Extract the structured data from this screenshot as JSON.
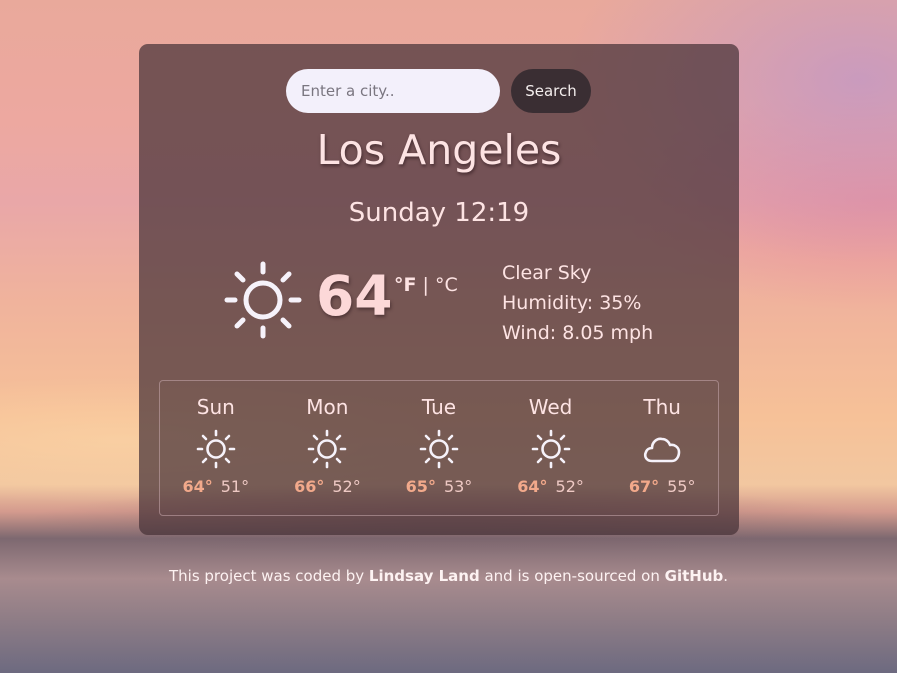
{
  "search": {
    "placeholder": "Enter a city..",
    "value": "",
    "button_label": "Search"
  },
  "current": {
    "city": "Los Angeles",
    "datetime": "Sunday 12:19",
    "icon": "sun-icon",
    "temperature": "64",
    "unit_f": "°F",
    "unit_separator": "|",
    "unit_c": "°C",
    "description": "Clear Sky",
    "humidity": "Humidity: 35%",
    "wind": "Wind: 8.05 mph"
  },
  "forecast": [
    {
      "day": "Sun",
      "icon": "sun-icon",
      "high": "64°",
      "low": "51°"
    },
    {
      "day": "Mon",
      "icon": "sun-icon",
      "high": "66°",
      "low": "52°"
    },
    {
      "day": "Tue",
      "icon": "sun-icon",
      "high": "65°",
      "low": "53°"
    },
    {
      "day": "Wed",
      "icon": "sun-icon",
      "high": "64°",
      "low": "52°"
    },
    {
      "day": "Thu",
      "icon": "cloud-icon",
      "high": "67°",
      "low": "55°"
    }
  ],
  "footer": {
    "text_1": "This project was coded by ",
    "author_link": "Lindsay Land",
    "text_2": " and is open-sourced on ",
    "github_link": "GitHub",
    "text_3": "."
  },
  "colors": {
    "accent_high": "#f2a98b",
    "text": "#fde3e3",
    "search_button_bg": "#3a2e33"
  }
}
